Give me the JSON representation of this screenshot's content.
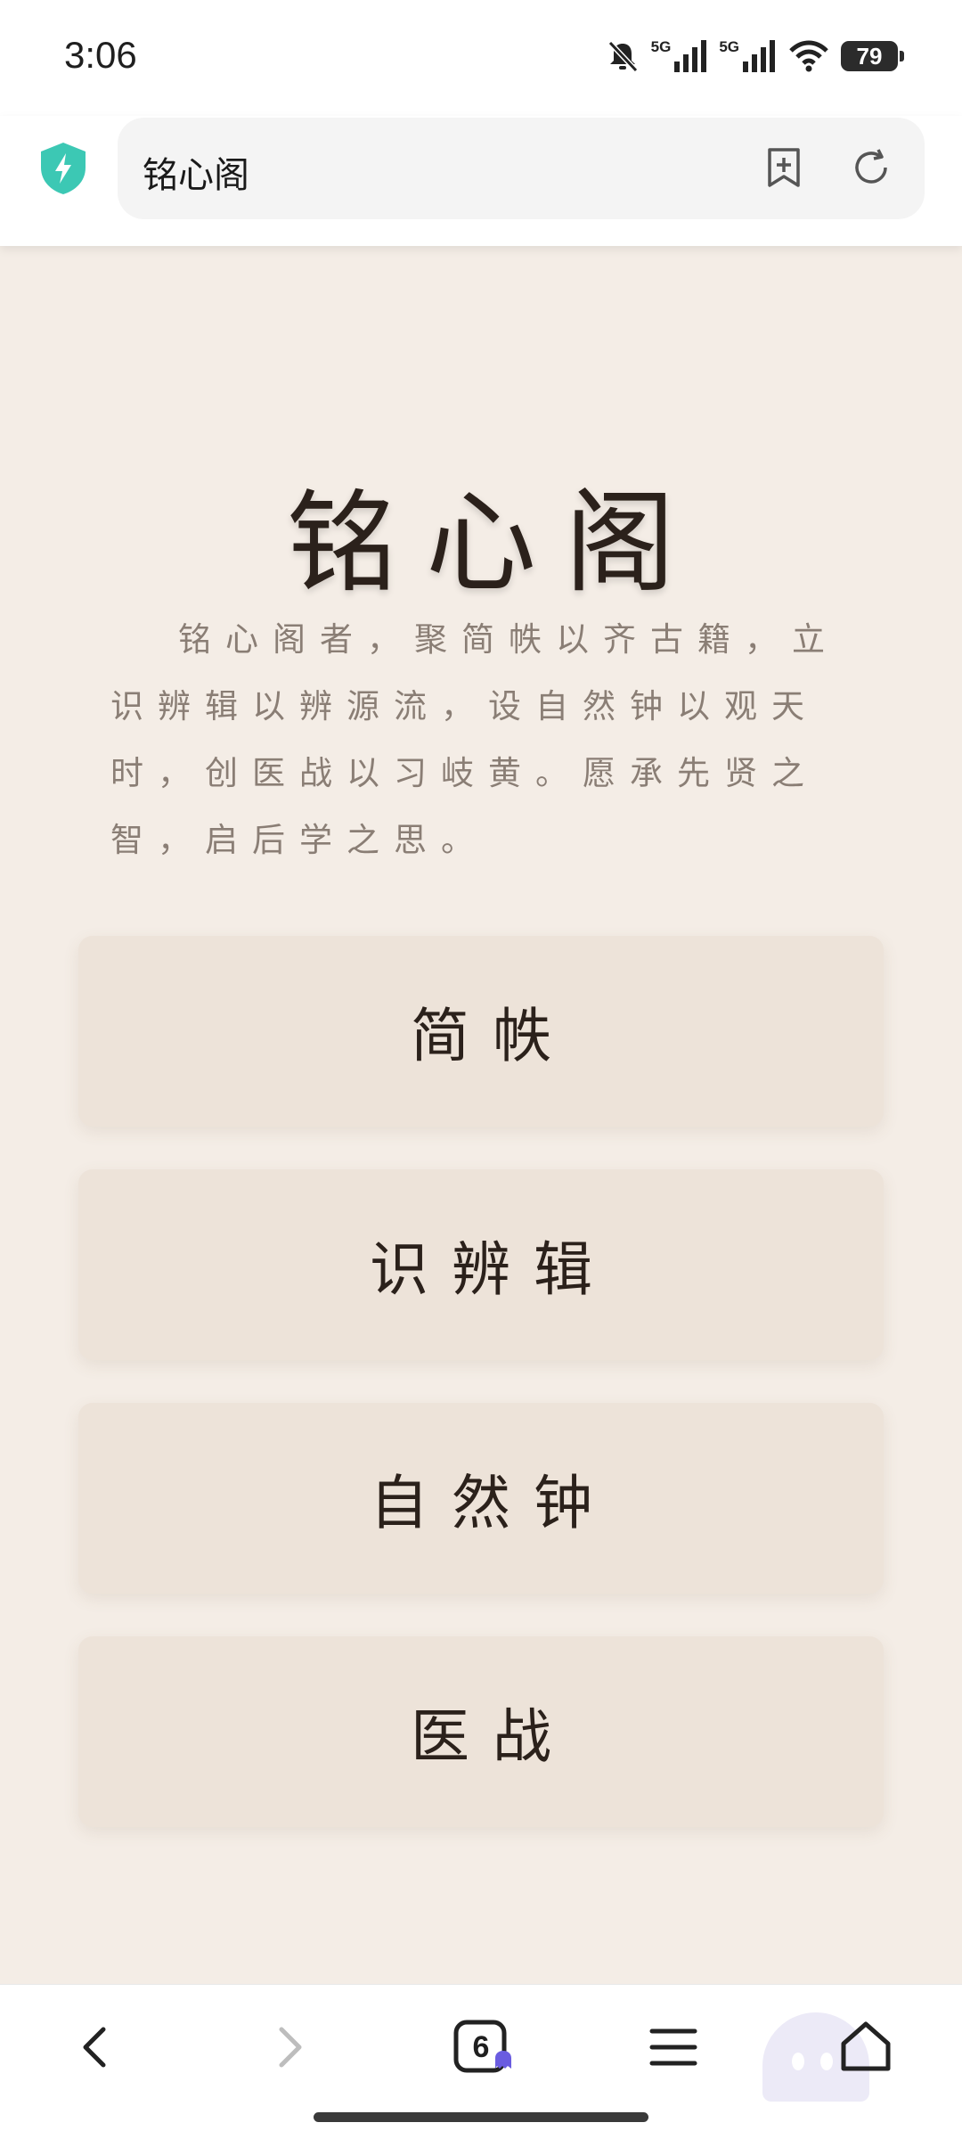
{
  "status_bar": {
    "time": "3:06",
    "signal_1_label": "5G",
    "signal_2_label": "5G",
    "battery": "79"
  },
  "address_bar": {
    "url_text": "铭心阁",
    "shield_color": "#3cc8b4"
  },
  "page": {
    "title": "铭心阁",
    "intro": "铭心阁者，聚简帙以齐古籍，立识辨辑以辨源流，设自然钟以观天时，创医战以习岐黄。愿承先贤之智，启后学之思。",
    "menu_items": [
      {
        "label": "简帙"
      },
      {
        "label": "识辨辑"
      },
      {
        "label": "自然钟"
      },
      {
        "label": "医战"
      }
    ]
  },
  "bottom_nav": {
    "tab_count": "6",
    "icons": [
      "back-icon",
      "forward-icon",
      "tabs-icon",
      "menu-icon",
      "home-icon"
    ]
  },
  "colors": {
    "background": "#f4ede6",
    "button": "#ede3d9",
    "text_dark": "#2b211b",
    "text_muted": "#8a7e75"
  }
}
